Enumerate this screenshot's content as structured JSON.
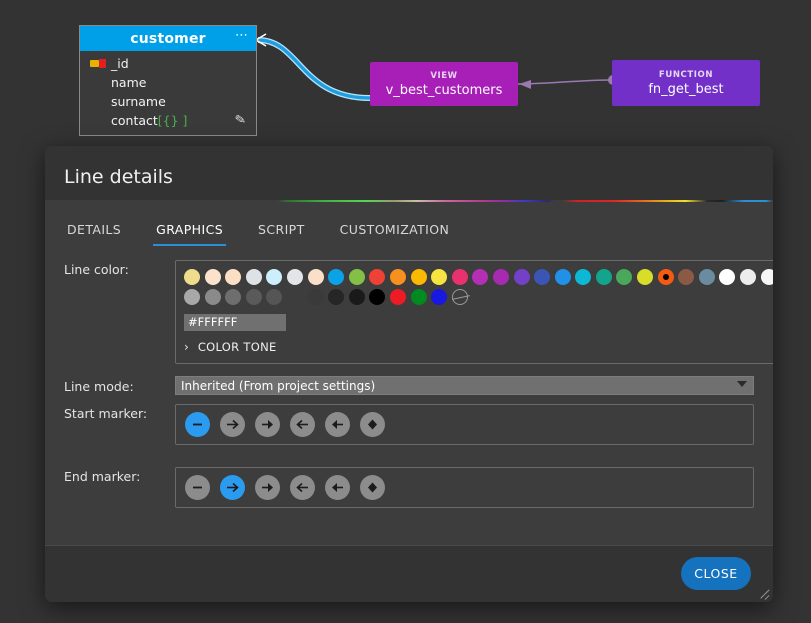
{
  "diagram": {
    "table": {
      "title": "customer",
      "menu_icon": "⋯",
      "edit_icon": "✎",
      "rows": [
        {
          "name": "_id",
          "type": "",
          "key": true
        },
        {
          "name": "name",
          "type": "",
          "key": false
        },
        {
          "name": "surname",
          "type": "",
          "key": false
        },
        {
          "name": "contact",
          "type": "[{} ]",
          "key": false
        }
      ]
    },
    "nodes": [
      {
        "kind": "VIEW",
        "name": "v_best_customers",
        "color": "#a81fb8"
      },
      {
        "kind": "FUNCTION",
        "name": "fn_get_best",
        "color": "#7230c8"
      }
    ]
  },
  "dialog": {
    "title": "Line details",
    "tabs": [
      {
        "label": "DETAILS",
        "active": false
      },
      {
        "label": "GRAPHICS",
        "active": true
      },
      {
        "label": "SCRIPT",
        "active": false
      },
      {
        "label": "CUSTOMIZATION",
        "active": false
      }
    ],
    "line_color": {
      "label": "Line color:",
      "hex_value": "#FFFFFF",
      "color_tone_label": "COLOR TONE",
      "chevron_icon": "›",
      "selected_index": 37,
      "row1": [
        "#efdc8c",
        "#fbe2cd",
        "#fbdfc4",
        "#dde2e6",
        "#cdeefc",
        "#e3e5e8",
        "#fbe0c9",
        "#0aa3e8",
        "#85c046",
        "#ef4136",
        "#f7901e",
        "#fbba00",
        "#f7e342",
        "#e8316e",
        "#b42fb4"
      ],
      "row2": [
        "#a8a8a8",
        "#8a8a8a",
        "#6e6e6e",
        "#5a5a5a",
        "#555555",
        "#3d3d3d",
        "#3a3a3a",
        "#262626",
        "#1a1a1a",
        "#000000",
        "#ed1c24",
        "#008a20",
        "#1818e0",
        "none"
      ],
      "row3": [
        "#a82ab0",
        "#7340c8",
        "#3b55b5",
        "#2090e8",
        "#0cb8d4",
        "#12a58c",
        "#4aa85a",
        "#d8dd2a",
        "#f45a10",
        "#8b5a44",
        "#6a8ca0",
        "#ffffff",
        "#ededed",
        "#f5f5f5",
        "#c8c8c8"
      ]
    },
    "line_mode": {
      "label": "Line mode:",
      "value": "Inherited (From project settings)"
    },
    "start_marker": {
      "label": "Start marker:",
      "selected_index": 0,
      "options": [
        "dash",
        "arrow-open-right",
        "arrow-filled-right",
        "arrow-open-left",
        "arrow-filled-left",
        "diamond"
      ]
    },
    "end_marker": {
      "label": "End marker:",
      "selected_index": 1,
      "options": [
        "dash",
        "arrow-open-right",
        "arrow-filled-right",
        "arrow-open-left",
        "arrow-filled-left",
        "diamond"
      ]
    },
    "close_label": "CLOSE"
  }
}
